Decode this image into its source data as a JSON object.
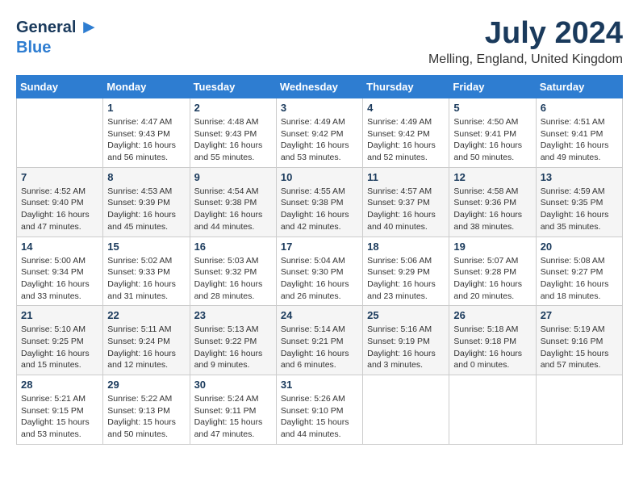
{
  "header": {
    "logo_general": "General",
    "logo_blue": "Blue",
    "month_year": "July 2024",
    "location": "Melling, England, United Kingdom"
  },
  "days_of_week": [
    "Sunday",
    "Monday",
    "Tuesday",
    "Wednesday",
    "Thursday",
    "Friday",
    "Saturday"
  ],
  "weeks": [
    [
      {
        "day": "",
        "info": ""
      },
      {
        "day": "1",
        "info": "Sunrise: 4:47 AM\nSunset: 9:43 PM\nDaylight: 16 hours\nand 56 minutes."
      },
      {
        "day": "2",
        "info": "Sunrise: 4:48 AM\nSunset: 9:43 PM\nDaylight: 16 hours\nand 55 minutes."
      },
      {
        "day": "3",
        "info": "Sunrise: 4:49 AM\nSunset: 9:42 PM\nDaylight: 16 hours\nand 53 minutes."
      },
      {
        "day": "4",
        "info": "Sunrise: 4:49 AM\nSunset: 9:42 PM\nDaylight: 16 hours\nand 52 minutes."
      },
      {
        "day": "5",
        "info": "Sunrise: 4:50 AM\nSunset: 9:41 PM\nDaylight: 16 hours\nand 50 minutes."
      },
      {
        "day": "6",
        "info": "Sunrise: 4:51 AM\nSunset: 9:41 PM\nDaylight: 16 hours\nand 49 minutes."
      }
    ],
    [
      {
        "day": "7",
        "info": "Sunrise: 4:52 AM\nSunset: 9:40 PM\nDaylight: 16 hours\nand 47 minutes."
      },
      {
        "day": "8",
        "info": "Sunrise: 4:53 AM\nSunset: 9:39 PM\nDaylight: 16 hours\nand 45 minutes."
      },
      {
        "day": "9",
        "info": "Sunrise: 4:54 AM\nSunset: 9:38 PM\nDaylight: 16 hours\nand 44 minutes."
      },
      {
        "day": "10",
        "info": "Sunrise: 4:55 AM\nSunset: 9:38 PM\nDaylight: 16 hours\nand 42 minutes."
      },
      {
        "day": "11",
        "info": "Sunrise: 4:57 AM\nSunset: 9:37 PM\nDaylight: 16 hours\nand 40 minutes."
      },
      {
        "day": "12",
        "info": "Sunrise: 4:58 AM\nSunset: 9:36 PM\nDaylight: 16 hours\nand 38 minutes."
      },
      {
        "day": "13",
        "info": "Sunrise: 4:59 AM\nSunset: 9:35 PM\nDaylight: 16 hours\nand 35 minutes."
      }
    ],
    [
      {
        "day": "14",
        "info": "Sunrise: 5:00 AM\nSunset: 9:34 PM\nDaylight: 16 hours\nand 33 minutes."
      },
      {
        "day": "15",
        "info": "Sunrise: 5:02 AM\nSunset: 9:33 PM\nDaylight: 16 hours\nand 31 minutes."
      },
      {
        "day": "16",
        "info": "Sunrise: 5:03 AM\nSunset: 9:32 PM\nDaylight: 16 hours\nand 28 minutes."
      },
      {
        "day": "17",
        "info": "Sunrise: 5:04 AM\nSunset: 9:30 PM\nDaylight: 16 hours\nand 26 minutes."
      },
      {
        "day": "18",
        "info": "Sunrise: 5:06 AM\nSunset: 9:29 PM\nDaylight: 16 hours\nand 23 minutes."
      },
      {
        "day": "19",
        "info": "Sunrise: 5:07 AM\nSunset: 9:28 PM\nDaylight: 16 hours\nand 20 minutes."
      },
      {
        "day": "20",
        "info": "Sunrise: 5:08 AM\nSunset: 9:27 PM\nDaylight: 16 hours\nand 18 minutes."
      }
    ],
    [
      {
        "day": "21",
        "info": "Sunrise: 5:10 AM\nSunset: 9:25 PM\nDaylight: 16 hours\nand 15 minutes."
      },
      {
        "day": "22",
        "info": "Sunrise: 5:11 AM\nSunset: 9:24 PM\nDaylight: 16 hours\nand 12 minutes."
      },
      {
        "day": "23",
        "info": "Sunrise: 5:13 AM\nSunset: 9:22 PM\nDaylight: 16 hours\nand 9 minutes."
      },
      {
        "day": "24",
        "info": "Sunrise: 5:14 AM\nSunset: 9:21 PM\nDaylight: 16 hours\nand 6 minutes."
      },
      {
        "day": "25",
        "info": "Sunrise: 5:16 AM\nSunset: 9:19 PM\nDaylight: 16 hours\nand 3 minutes."
      },
      {
        "day": "26",
        "info": "Sunrise: 5:18 AM\nSunset: 9:18 PM\nDaylight: 16 hours\nand 0 minutes."
      },
      {
        "day": "27",
        "info": "Sunrise: 5:19 AM\nSunset: 9:16 PM\nDaylight: 15 hours\nand 57 minutes."
      }
    ],
    [
      {
        "day": "28",
        "info": "Sunrise: 5:21 AM\nSunset: 9:15 PM\nDaylight: 15 hours\nand 53 minutes."
      },
      {
        "day": "29",
        "info": "Sunrise: 5:22 AM\nSunset: 9:13 PM\nDaylight: 15 hours\nand 50 minutes."
      },
      {
        "day": "30",
        "info": "Sunrise: 5:24 AM\nSunset: 9:11 PM\nDaylight: 15 hours\nand 47 minutes."
      },
      {
        "day": "31",
        "info": "Sunrise: 5:26 AM\nSunset: 9:10 PM\nDaylight: 15 hours\nand 44 minutes."
      },
      {
        "day": "",
        "info": ""
      },
      {
        "day": "",
        "info": ""
      },
      {
        "day": "",
        "info": ""
      }
    ]
  ]
}
